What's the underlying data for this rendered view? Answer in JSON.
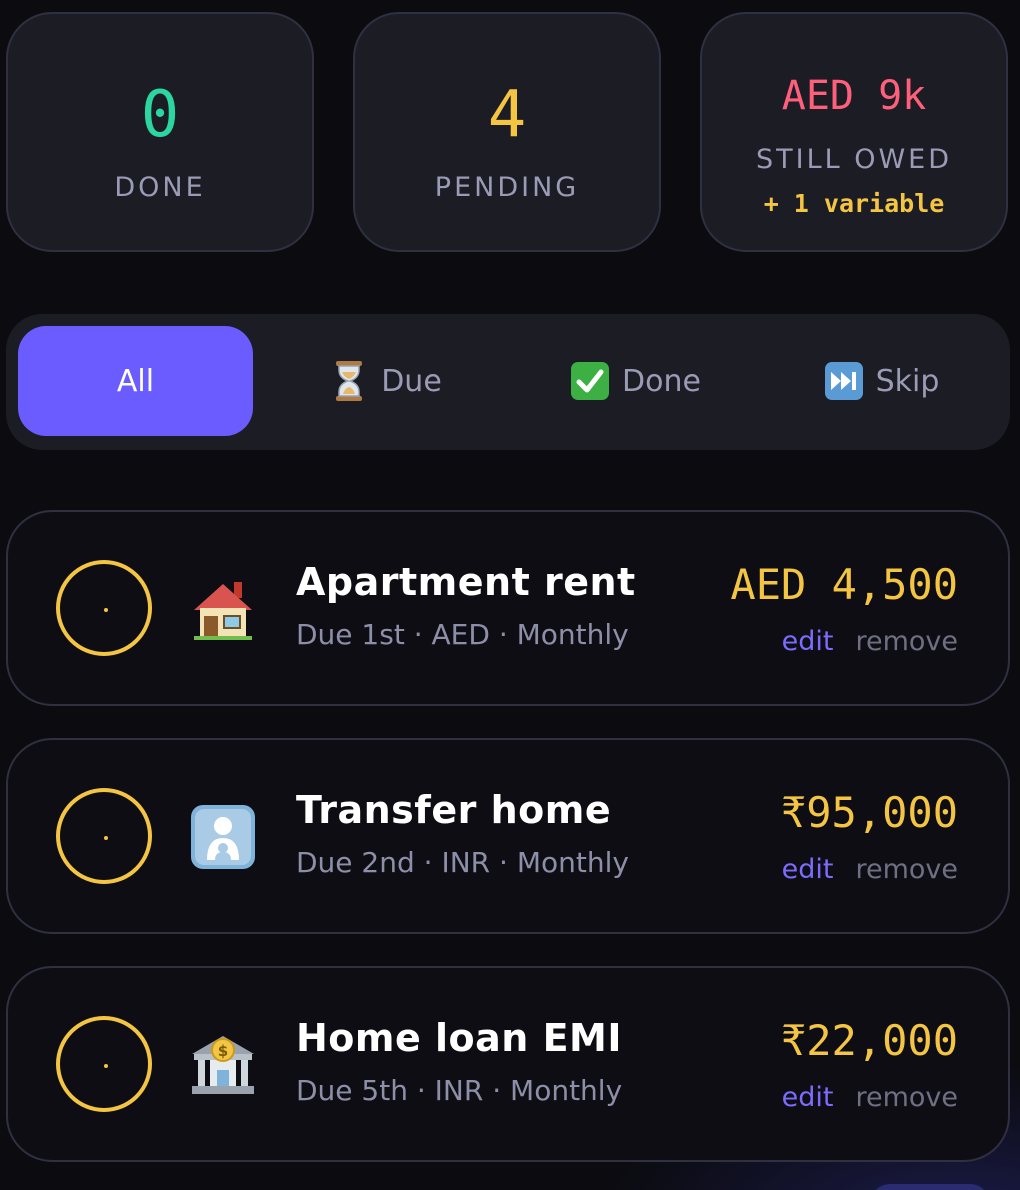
{
  "summary": {
    "done": {
      "value": "0",
      "label": "DONE",
      "color": "#2bd6a0"
    },
    "pending": {
      "value": "4",
      "label": "PENDING",
      "color": "#f4c542"
    },
    "owed": {
      "value": "AED 9k",
      "label": "STILL OWED",
      "note": "+ 1 variable",
      "color": "#ff5f7a"
    }
  },
  "filters": {
    "active": "All",
    "tabs": [
      {
        "label": "All",
        "icon": ""
      },
      {
        "label": "Due",
        "icon": "hourglass-icon"
      },
      {
        "label": "Done",
        "icon": "check-mark-button-icon"
      },
      {
        "label": "Skip",
        "icon": "skip-forward-icon"
      }
    ]
  },
  "bills": [
    {
      "name": "Apartment rent",
      "meta": "Due 1st · AED · Monthly",
      "amount": "AED 4,500",
      "icon": "house-icon",
      "edit": "edit",
      "remove": "remove"
    },
    {
      "name": "Transfer home",
      "meta": "Due 2nd · INR · Monthly",
      "amount": "₹95,000",
      "icon": "family-transfer-icon",
      "edit": "edit",
      "remove": "remove"
    },
    {
      "name": "Home loan EMI",
      "meta": "Due 5th · INR · Monthly",
      "amount": "₹22,000",
      "icon": "bank-icon",
      "edit": "edit",
      "remove": "remove"
    }
  ],
  "colors": {
    "accent": "#6b5cff",
    "amount": "#f4c542",
    "edit": "#7b6cff"
  }
}
